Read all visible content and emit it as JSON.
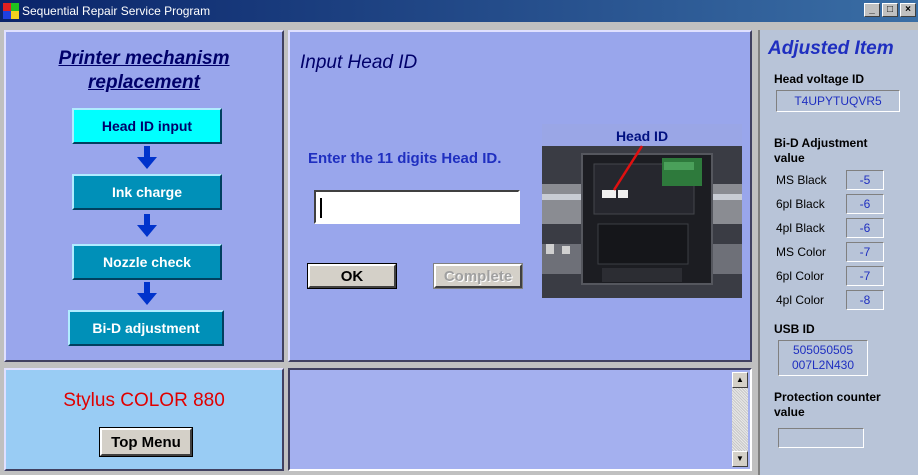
{
  "window": {
    "title": "Sequential Repair Service Program",
    "buttons": [
      "_",
      "□",
      "×"
    ]
  },
  "flow": {
    "title_line1": "Printer mechanism",
    "title_line2": "replacement",
    "steps": [
      "Head ID input",
      "Ink charge",
      "Nozzle check",
      "Bi-D adjustment"
    ],
    "active_step": 0
  },
  "model": {
    "name": "Stylus COLOR 880",
    "top_menu_label": "Top Menu"
  },
  "input": {
    "title": "Input Head ID",
    "prompt": "Enter the 11 digits Head ID.",
    "field_value": "",
    "ok_label": "OK",
    "complete_label": "Complete",
    "photo_label": "Head ID"
  },
  "adjusted": {
    "title": "Adjusted Item",
    "head_voltage_label": "Head voltage ID",
    "head_voltage_value": "T4UPYTUQVR5",
    "bid_label_line1": "Bi-D Adjustment",
    "bid_label_line2": "value",
    "bid_rows": [
      {
        "name": "MS Black",
        "value": "-5"
      },
      {
        "name": "6pl Black",
        "value": "-6"
      },
      {
        "name": "4pl Black",
        "value": "-6"
      },
      {
        "name": "MS Color",
        "value": "-7"
      },
      {
        "name": "6pl Color",
        "value": "-7"
      },
      {
        "name": "4pl Color",
        "value": "-8"
      }
    ],
    "usb_label": "USB ID",
    "usb_line1": "505050505",
    "usb_line2": "007L2N430",
    "protection_label_line1": "Protection counter",
    "protection_label_line2": "value",
    "protection_value": ""
  },
  "colors": {
    "panel_blue": "#99a6ec",
    "accent_cyan": "#00ffff",
    "step_teal": "#0090b8",
    "arrow_blue": "#0033cc",
    "model_red": "#e00000"
  }
}
